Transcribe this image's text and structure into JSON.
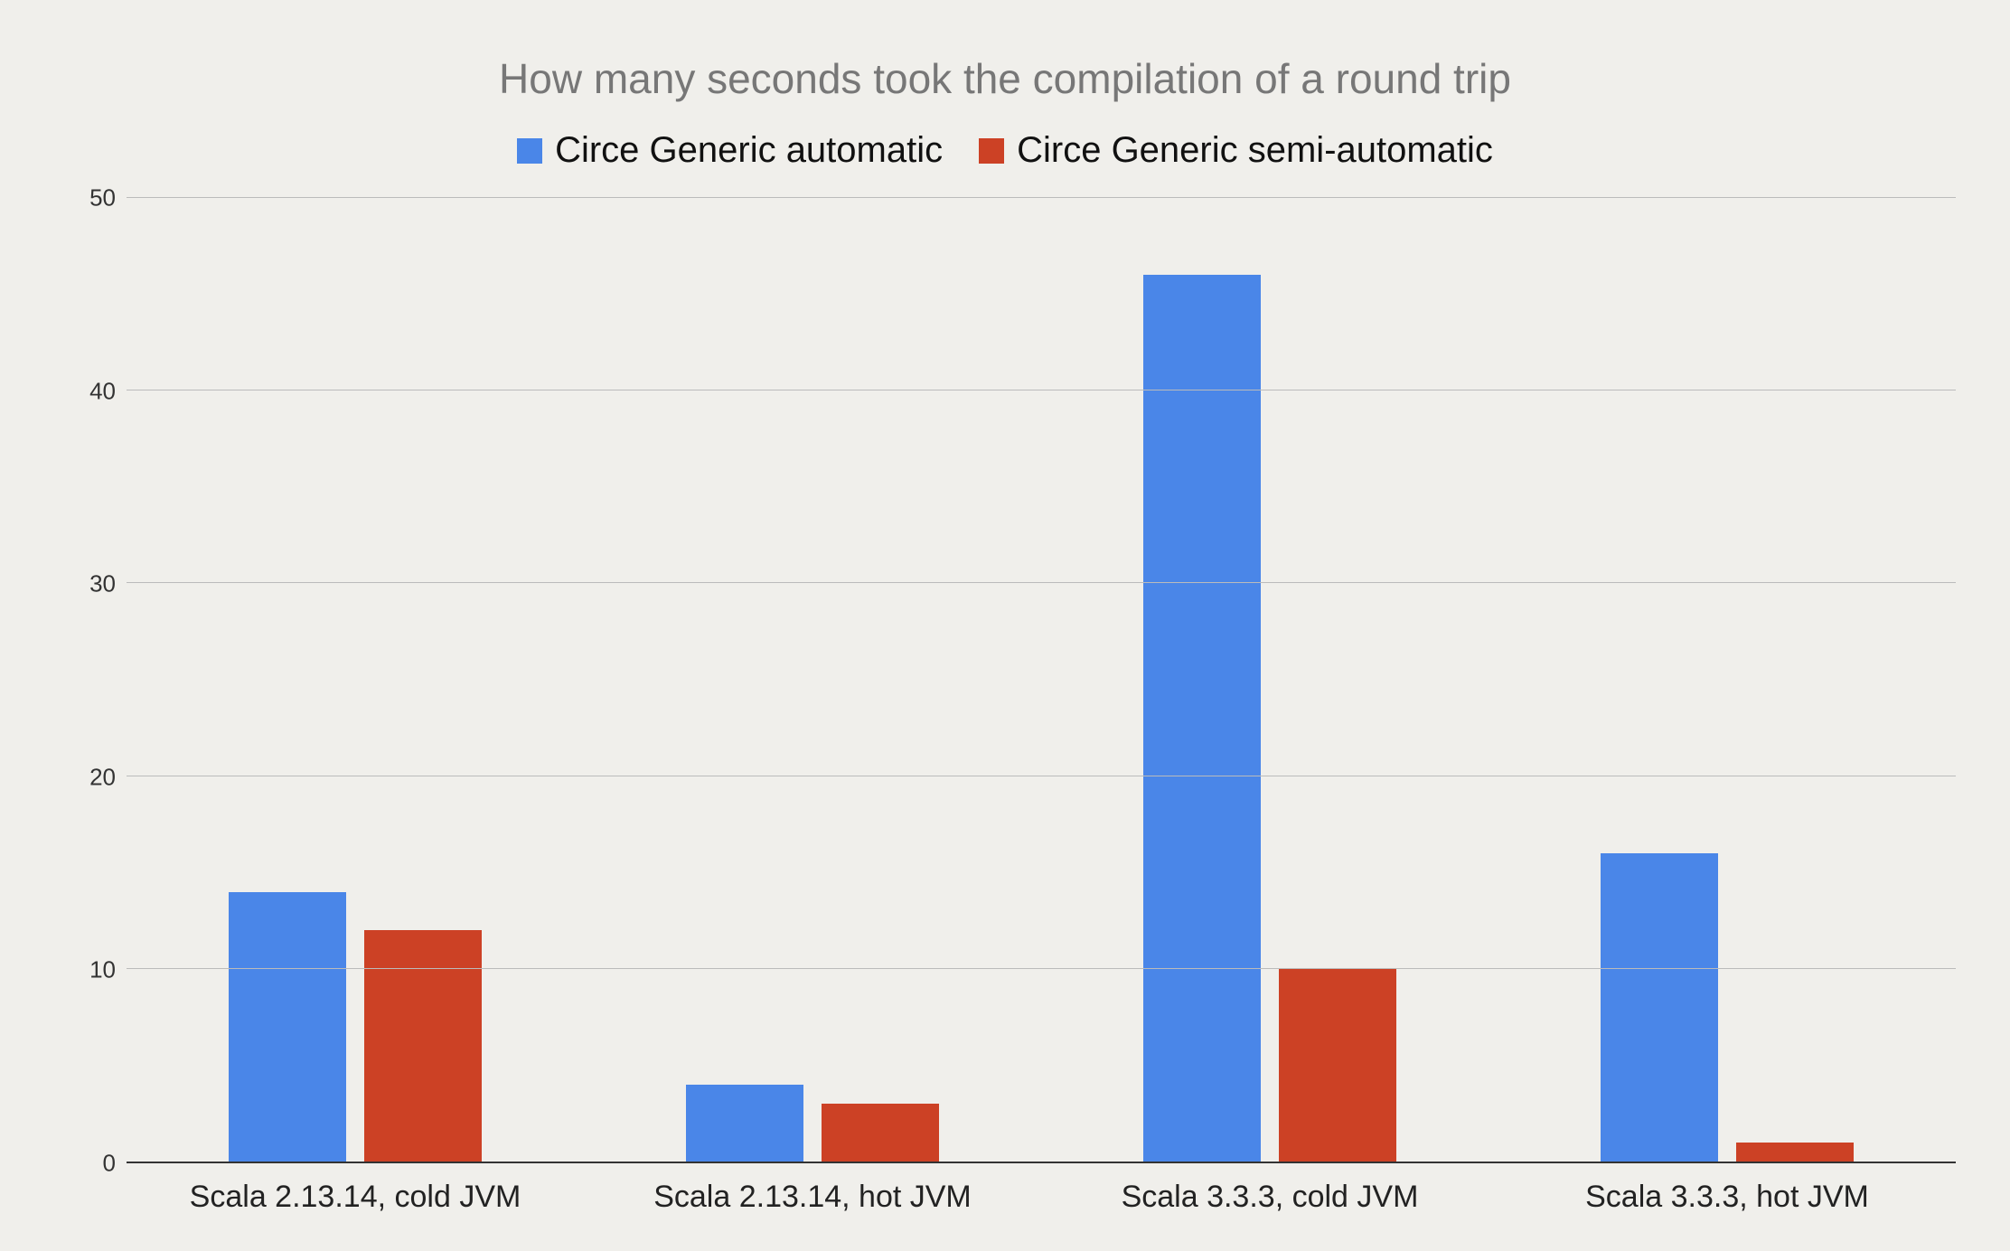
{
  "chart_data": {
    "type": "bar",
    "title": "How many seconds took the compilation of a round trip",
    "xlabel": "",
    "ylabel": "",
    "ylim": [
      0,
      50
    ],
    "yticks": [
      0,
      10,
      20,
      30,
      40,
      50
    ],
    "categories": [
      "Scala 2.13.14, cold JVM",
      "Scala 2.13.14, hot JVM",
      "Scala 3.3.3, cold JVM",
      "Scala 3.3.3, hot JVM"
    ],
    "series": [
      {
        "name": "Circe Generic automatic",
        "color": "#4a86e8",
        "values": [
          14,
          4,
          46,
          16
        ]
      },
      {
        "name": "Circe Generic semi-automatic",
        "color": "#cc4125",
        "values": [
          12,
          3,
          10,
          1
        ]
      }
    ],
    "legend_position": "top",
    "grid": true
  }
}
